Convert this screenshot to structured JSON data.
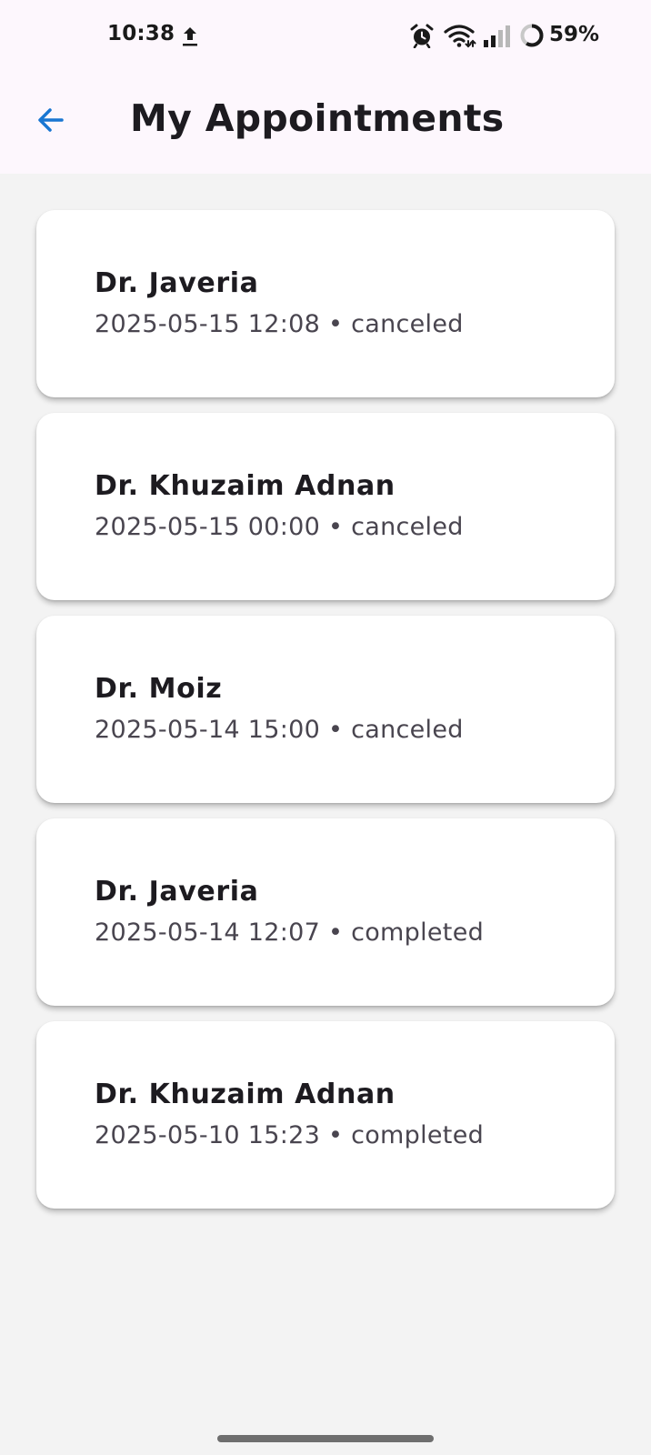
{
  "status_bar": {
    "time": "10:38",
    "battery_percent": "59%",
    "battery_level": 0.59,
    "icons": [
      "upload-icon",
      "alarm-icon",
      "wifi-icon",
      "signal-icon",
      "battery-icon"
    ]
  },
  "app_bar": {
    "back_icon": "arrow-left-icon",
    "title": "My Appointments"
  },
  "colors": {
    "accent": "#1976d2",
    "header_background": "#fdf7fd",
    "page_background": "#f3f3f3",
    "card_background": "#ffffff",
    "title_text": "#1d1b20",
    "subtitle_text": "#49454f"
  },
  "appointments": [
    {
      "doctor": "Dr. Javeria",
      "details": "2025-05-15 12:08 • canceled"
    },
    {
      "doctor": "Dr. Khuzaim Adnan",
      "details": "2025-05-15 00:00 • canceled"
    },
    {
      "doctor": "Dr. Moiz",
      "details": "2025-05-14 15:00 • canceled"
    },
    {
      "doctor": "Dr. Javeria",
      "details": "2025-05-14 12:07 • completed"
    },
    {
      "doctor": "Dr. Khuzaim Adnan",
      "details": "2025-05-10 15:23 • completed"
    }
  ]
}
